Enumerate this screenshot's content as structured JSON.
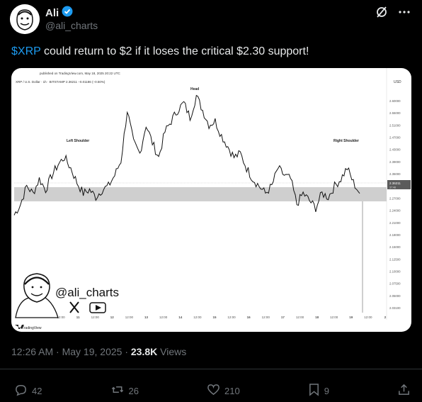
{
  "author": {
    "name": "Ali",
    "handle": "@ali_charts",
    "verified_color": "#1d9bf0"
  },
  "header_icons": [
    "grok-icon",
    "more-icon"
  ],
  "tweet": {
    "cashtag": "$XRP",
    "text_rest": " could return to $2 if it loses the critical $2.30 support!"
  },
  "chart": {
    "published": "published on TradingView.com, May 18, 2025 20:22 UTC",
    "symbol_line": "XRP / U.S. Dollar · 1h · BITSTAMP  2.36211  −0.01186 (−0.50%)",
    "currency": "USD",
    "watermark_handle": "@ali_charts",
    "brand": "TradingView",
    "annotations": {
      "left": "Left Shoulder",
      "head": "Head",
      "right": "Right Shoulder"
    },
    "last_price": "2.36211",
    "last_price_sub": "37:48"
  },
  "chart_data": {
    "type": "line",
    "title": "",
    "xlabel": "",
    "ylabel": "",
    "x_ticks": [
      "12:00",
      "11",
      "12:00",
      "12",
      "12:00",
      "13",
      "12:00",
      "14",
      "12:00",
      "15",
      "12:00",
      "16",
      "12:00",
      "17",
      "12:00",
      "18",
      "12:00",
      "19",
      "12:00",
      "2"
    ],
    "y_ticks": [
      "2.60000",
      "2.55000",
      "2.51000",
      "2.47000",
      "2.43000",
      "2.39000",
      "2.35000",
      "2.31000",
      "2.27000",
      "2.24000",
      "2.21000",
      "2.18000",
      "2.15000",
      "2.12500",
      "2.10000",
      "2.07500",
      "2.05000",
      "2.03100"
    ],
    "series": [
      {
        "values": [
          2.3,
          2.33,
          2.38,
          2.36,
          2.4,
          2.37,
          2.41,
          2.44,
          2.46,
          2.43,
          2.39,
          2.36,
          2.37,
          2.35,
          2.37,
          2.38,
          2.41,
          2.45,
          2.59,
          2.5,
          2.47,
          2.55,
          2.5,
          2.46,
          2.53,
          2.56,
          2.59,
          2.61,
          2.57,
          2.63,
          2.59,
          2.55,
          2.56,
          2.52,
          2.49,
          2.46,
          2.47,
          2.43,
          2.4,
          2.38,
          2.36,
          2.38,
          2.43,
          2.41,
          2.4,
          2.33,
          2.36,
          2.34,
          2.32,
          2.36,
          2.35,
          2.38,
          2.4,
          2.43,
          2.39,
          2.36
        ]
      }
    ],
    "support_band": [
      2.32,
      2.35
    ],
    "ylim": [
      2.03,
      2.64
    ]
  },
  "meta": {
    "time": "12:26 AM · May 19, 2025 · ",
    "views_count": "23.8K",
    "views_label": " Views"
  },
  "actions": {
    "replies": "42",
    "reposts": "26",
    "likes": "210",
    "bookmarks": "9"
  }
}
